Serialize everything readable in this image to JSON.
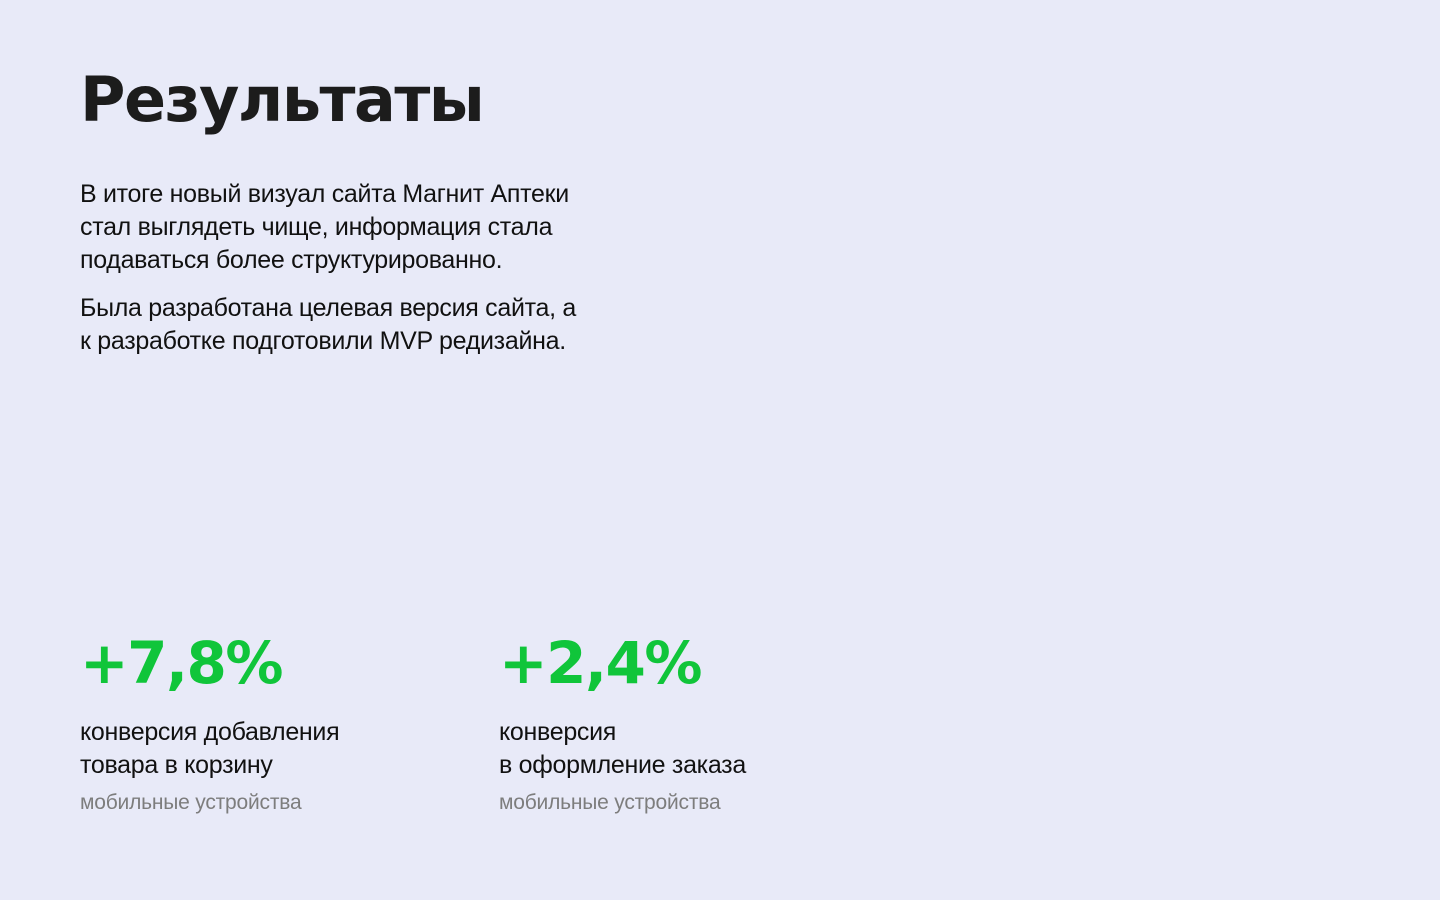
{
  "title": "Результаты",
  "intro": {
    "paragraph_1": "В итоге новый визуал сайта Магнит Аптеки стал выглядеть чище, информация  стала подаваться более структурированно.",
    "paragraph_2": "Была разработана целевая версия сайта, а к разработке подготовили MVP редизайна."
  },
  "metrics": [
    {
      "value": "+7,8%",
      "label": "конверсия добавления\nтовара в корзину",
      "note": "мобильные устройства"
    },
    {
      "value": "+2,4%",
      "label": "конверсия\nв оформление заказа",
      "note": "мобильные устройства"
    }
  ],
  "colors": {
    "background": "#e8eaf8",
    "accent_green": "#10c53a",
    "text_primary": "#111111",
    "text_secondary": "#7d7d7d"
  }
}
